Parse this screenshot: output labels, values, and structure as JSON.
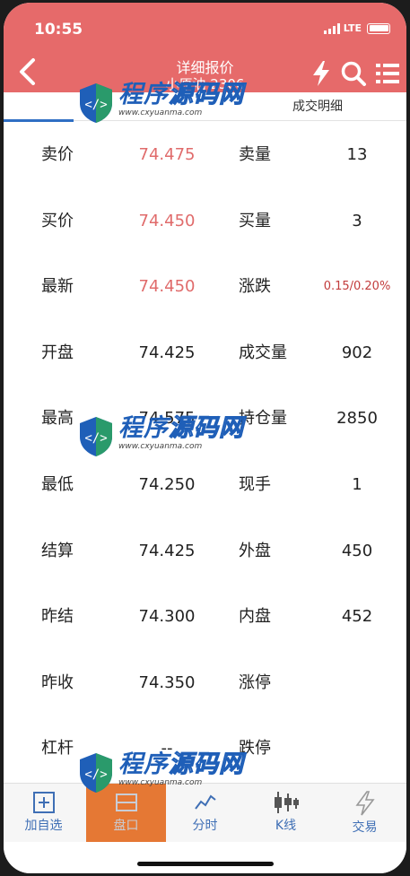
{
  "status": {
    "time": "10:55",
    "network": "LTE"
  },
  "header": {
    "title": "详细报价",
    "subtitle": "小原油 2306"
  },
  "tabs": {
    "trades": "成交明细"
  },
  "quotes": [
    {
      "label1": "卖价",
      "value1": "74.475",
      "label2": "卖量",
      "value2": "13"
    },
    {
      "label1": "买价",
      "value1": "74.450",
      "label2": "买量",
      "value2": "3"
    },
    {
      "label1": "最新",
      "value1": "74.450",
      "label2": "涨跌",
      "value2": "0.15/0.20%"
    },
    {
      "label1": "开盘",
      "value1": "74.425",
      "label2": "成交量",
      "value2": "902"
    },
    {
      "label1": "最高",
      "value1": "74.575",
      "label2": "持仓量",
      "value2": "2850"
    },
    {
      "label1": "最低",
      "value1": "74.250",
      "label2": "现手",
      "value2": "1"
    },
    {
      "label1": "结算",
      "value1": "74.425",
      "label2": "外盘",
      "value2": "450"
    },
    {
      "label1": "昨结",
      "value1": "74.300",
      "label2": "内盘",
      "value2": "452"
    },
    {
      "label1": "昨收",
      "value1": "74.350",
      "label2": "涨停",
      "value2": ""
    },
    {
      "label1": "杠杆",
      "value1": "--",
      "label2": "跌停",
      "value2": ""
    }
  ],
  "tabbar": [
    {
      "label": "加自选",
      "icon": "add-watchlist-icon"
    },
    {
      "label": "盘口",
      "icon": "orderbook-icon"
    },
    {
      "label": "分时",
      "icon": "timeshare-icon"
    },
    {
      "label": "K线",
      "icon": "candlestick-icon"
    },
    {
      "label": "交易",
      "icon": "lightning-icon"
    }
  ],
  "watermark": {
    "text_blue": "程序",
    "text_outline": "源码网",
    "url": "www.cxyuanma.com"
  },
  "colors": {
    "header": "#e66a6a",
    "price_red": "#e06b6b",
    "active_tab": "#e57834",
    "link_blue": "#3f6fb5"
  }
}
